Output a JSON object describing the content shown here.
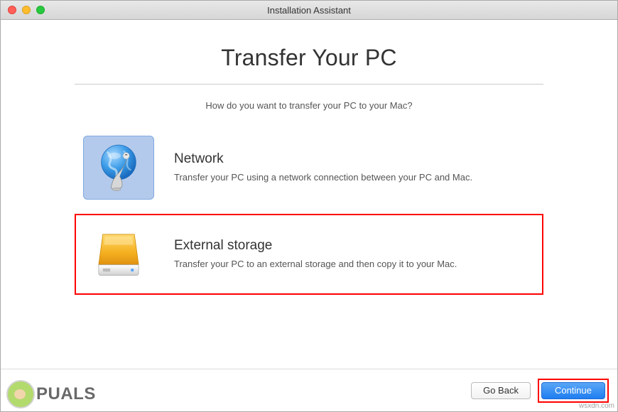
{
  "window": {
    "title": "Installation Assistant"
  },
  "page": {
    "heading": "Transfer Your PC",
    "subheading": "How do you want to transfer your PC to your Mac?"
  },
  "options": {
    "network": {
      "title": "Network",
      "description": "Transfer your PC using a network connection between your PC and Mac."
    },
    "external": {
      "title": "External storage",
      "description": "Transfer your PC to an external storage and then copy it to your Mac."
    }
  },
  "buttons": {
    "go_back": "Go Back",
    "continue": "Continue"
  },
  "watermark": {
    "brand": "PUALS",
    "site": "wsxdn.com"
  }
}
